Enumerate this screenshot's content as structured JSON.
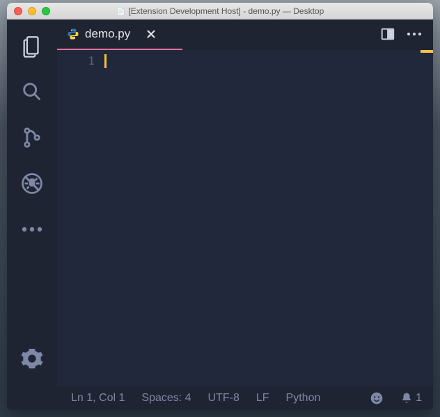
{
  "title": {
    "text": "[Extension Development Host] - demo.py — Desktop"
  },
  "tab": {
    "filename": "demo.py"
  },
  "gutter": {
    "line1": "1"
  },
  "status": {
    "pos": "Ln 1, Col 1",
    "indent": "Spaces: 4",
    "encoding": "UTF-8",
    "eol": "LF",
    "lang": "Python",
    "notif_count": "1"
  }
}
